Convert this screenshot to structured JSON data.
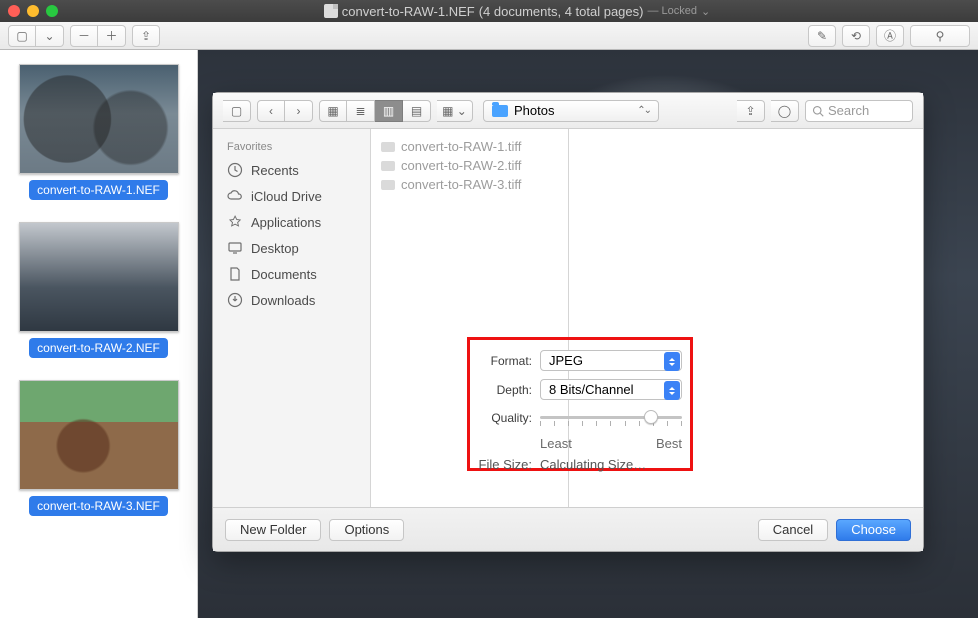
{
  "window": {
    "filename": "convert-to-RAW-1.NEF",
    "docinfo": "(4 documents, 4 total pages)",
    "locked": "— Locked"
  },
  "thumbs": [
    {
      "label": "convert-to-RAW-1.NEF"
    },
    {
      "label": "convert-to-RAW-2.NEF"
    },
    {
      "label": "convert-to-RAW-3.NEF"
    }
  ],
  "sheet": {
    "location": "Photos",
    "search_placeholder": "Search",
    "fav_header": "Favorites",
    "favorites": [
      {
        "label": "Recents",
        "icon": "clock-icon"
      },
      {
        "label": "iCloud Drive",
        "icon": "cloud-icon"
      },
      {
        "label": "Applications",
        "icon": "apps-icon"
      },
      {
        "label": "Desktop",
        "icon": "desktop-icon"
      },
      {
        "label": "Documents",
        "icon": "documents-icon"
      },
      {
        "label": "Downloads",
        "icon": "downloads-icon"
      }
    ],
    "files": [
      "convert-to-RAW-1.tiff",
      "convert-to-RAW-2.tiff",
      "convert-to-RAW-3.tiff"
    ],
    "settings": {
      "format_label": "Format:",
      "format_value": "JPEG",
      "depth_label": "Depth:",
      "depth_value": "8 Bits/Channel",
      "quality_label": "Quality:",
      "quality_least": "Least",
      "quality_best": "Best",
      "quality_position_pct": 78,
      "filesize_label": "File Size:",
      "filesize_value": "Calculating Size…"
    },
    "buttons": {
      "new_folder": "New Folder",
      "options": "Options",
      "cancel": "Cancel",
      "choose": "Choose"
    }
  }
}
